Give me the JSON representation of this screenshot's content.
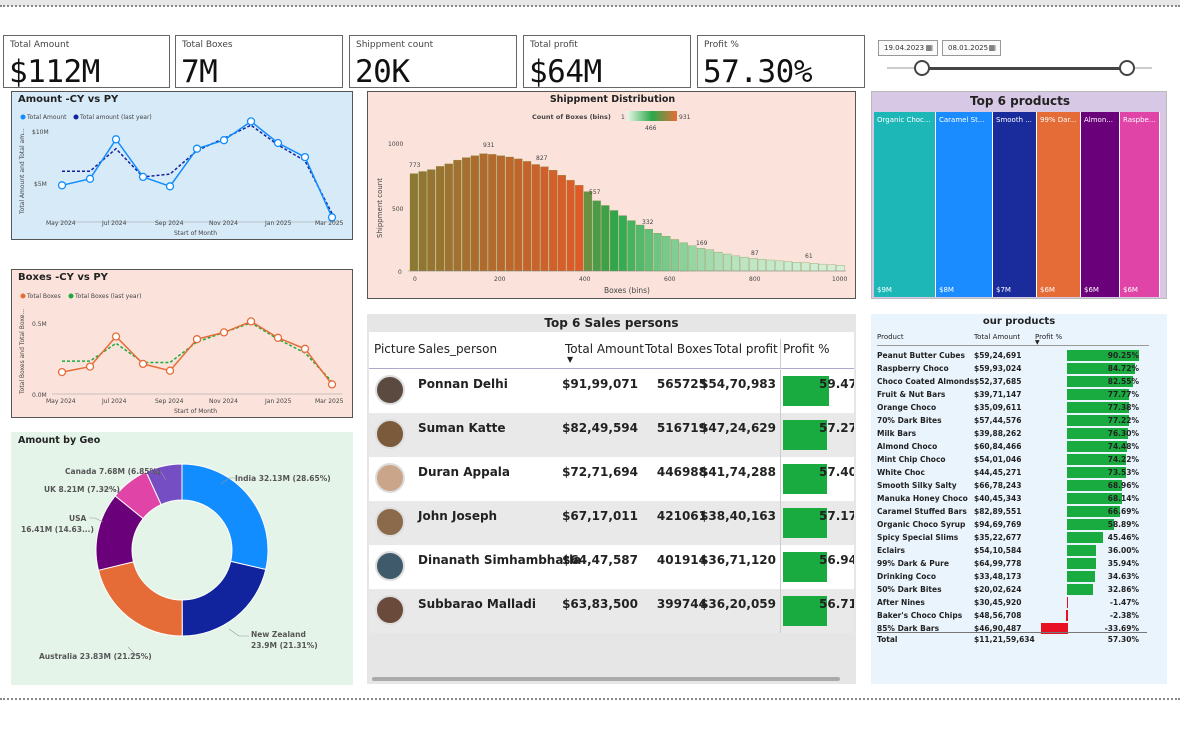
{
  "kpis": [
    {
      "label": "Total Amount",
      "value": "$112M"
    },
    {
      "label": "Total Boxes",
      "value": "7M"
    },
    {
      "label": "Shippment count",
      "value": "20K"
    },
    {
      "label": "Total profit",
      "value": "$64M"
    },
    {
      "label": "Profit %",
      "value": "57.30%"
    }
  ],
  "date_filter": {
    "start": "19.04.2023",
    "end": "08.01.2025",
    "start_pos": 0.0,
    "end_pos": 1.0
  },
  "amount_chart": {
    "title": "Amount -CY vs PY",
    "legend": [
      "Total Amount",
      "Total amount (last year)"
    ],
    "ylabel": "Total Amount and Total am...",
    "xlabel": "Start of Month",
    "yticks": [
      "$10M",
      "$5M"
    ],
    "xticks": [
      "May 2024",
      "Jul 2024",
      "Sep 2024",
      "Nov 2024",
      "Jan 2025",
      "Mar 2025"
    ]
  },
  "boxes_chart": {
    "title": "Boxes -CY vs PY",
    "legend": [
      "Total Boxes",
      "Total Boxes (last year)"
    ],
    "ylabel": "Total Boxes and Total Boxe...",
    "xlabel": "Start of Month",
    "yticks": [
      "0.5M",
      "0.0M"
    ],
    "xticks": [
      "May 2024",
      "Jul 2024",
      "Sep 2024",
      "Nov 2024",
      "Jan 2025",
      "Mar 2025"
    ]
  },
  "shipment_chart": {
    "title": "Shippment Distribution",
    "legend_label": "Count of Boxes (bins)",
    "legend_min": "1",
    "legend_mid": "466",
    "legend_max": "931",
    "xlabel": "Boxes (bins)",
    "ylabel": "Shippment count",
    "yticks": [
      "1000",
      "500",
      "0"
    ],
    "xticks": [
      "0",
      "200",
      "400",
      "600",
      "800",
      "1000"
    ],
    "labels": [
      "773",
      "931",
      "827",
      "557",
      "332",
      "169",
      "87",
      "61"
    ]
  },
  "top_products": {
    "title": "Top 6 products",
    "items": [
      {
        "name": "Organic Choc...",
        "value": "$9M",
        "color": "#1eb7b7"
      },
      {
        "name": "Caramel St...",
        "value": "$8M",
        "color": "#1a8cff"
      },
      {
        "name": "Smooth ...",
        "value": "$7M",
        "color": "#1a2b9c"
      },
      {
        "name": "99% Dar...",
        "value": "$6M",
        "color": "#e66c37"
      },
      {
        "name": "Almon...",
        "value": "$6M",
        "color": "#6b007b"
      },
      {
        "name": "Raspbe...",
        "value": "$6M",
        "color": "#e044a7"
      }
    ]
  },
  "sales_persons": {
    "title": "Top 6 Sales persons",
    "columns": [
      "Picture",
      "Sales_person",
      "Total Amount",
      "Total Boxes",
      "Total profit",
      "Profit %"
    ],
    "rows": [
      {
        "name": "Ponnan Delhi",
        "amount": "$91,99,071",
        "boxes": "565725",
        "profit": "$54,70,983",
        "pct": "59.47",
        "pct_val": 59.47
      },
      {
        "name": "Suman Katte",
        "amount": "$82,49,594",
        "boxes": "516719",
        "profit": "$47,24,629",
        "pct": "57.27",
        "pct_val": 57.27
      },
      {
        "name": "Duran Appala",
        "amount": "$72,71,694",
        "boxes": "446988",
        "profit": "$41,74,288",
        "pct": "57.40",
        "pct_val": 57.4
      },
      {
        "name": "John Joseph",
        "amount": "$67,17,011",
        "boxes": "421061",
        "profit": "$38,40,163",
        "pct": "57.17",
        "pct_val": 57.17
      },
      {
        "name": "Dinanath Simhambhatla",
        "amount": "$64,47,587",
        "boxes": "401914",
        "profit": "$36,71,120",
        "pct": "56.94",
        "pct_val": 56.94
      },
      {
        "name": "Subbarao Malladi",
        "amount": "$63,83,500",
        "boxes": "399744",
        "profit": "$36,20,059",
        "pct": "56.71",
        "pct_val": 56.71
      }
    ]
  },
  "geo_chart": {
    "title": "Amount by Geo",
    "slices": [
      {
        "label": "India 32.13M (28.65%)",
        "value": 28.65,
        "color": "#118dff"
      },
      {
        "label": "New Zealand",
        "label2": "23.9M (21.31%)",
        "value": 21.31,
        "color": "#12239e"
      },
      {
        "label": "Australia 23.83M (21.25%)",
        "value": 21.25,
        "color": "#e66c37"
      },
      {
        "label": "USA",
        "label2": "16.41M (14.63...)",
        "value": 14.63,
        "color": "#6b007b"
      },
      {
        "label": "UK 8.21M (7.32%)",
        "value": 7.32,
        "color": "#e044a7"
      },
      {
        "label": "Canada 7.68M (6.85%)",
        "value": 6.85,
        "color": "#744ec2"
      }
    ]
  },
  "our_products": {
    "title": "our products",
    "columns": [
      "Product",
      "Total Amount",
      "Profit %"
    ],
    "rows": [
      {
        "name": "Peanut Butter Cubes",
        "amount": "$59,24,691",
        "pct": "90.25%",
        "v": 90.25
      },
      {
        "name": "Raspberry Choco",
        "amount": "$59,93,024",
        "pct": "84.72%",
        "v": 84.72
      },
      {
        "name": "Choco Coated Almonds",
        "amount": "$52,37,685",
        "pct": "82.55%",
        "v": 82.55
      },
      {
        "name": "Fruit & Nut Bars",
        "amount": "$39,71,147",
        "pct": "77.77%",
        "v": 77.77
      },
      {
        "name": "Orange Choco",
        "amount": "$35,09,611",
        "pct": "77.38%",
        "v": 77.38
      },
      {
        "name": "70% Dark Bites",
        "amount": "$57,44,576",
        "pct": "77.22%",
        "v": 77.22
      },
      {
        "name": "Milk Bars",
        "amount": "$39,88,262",
        "pct": "76.30%",
        "v": 76.3
      },
      {
        "name": "Almond Choco",
        "amount": "$60,84,466",
        "pct": "74.48%",
        "v": 74.48
      },
      {
        "name": "Mint Chip Choco",
        "amount": "$54,01,046",
        "pct": "74.22%",
        "v": 74.22
      },
      {
        "name": "White Choc",
        "amount": "$44,45,271",
        "pct": "73.53%",
        "v": 73.53
      },
      {
        "name": "Smooth Silky Salty",
        "amount": "$66,78,243",
        "pct": "68.96%",
        "v": 68.96
      },
      {
        "name": "Manuka Honey Choco",
        "amount": "$40,45,343",
        "pct": "68.14%",
        "v": 68.14
      },
      {
        "name": "Caramel Stuffed Bars",
        "amount": "$82,89,551",
        "pct": "66.69%",
        "v": 66.69
      },
      {
        "name": "Organic Choco Syrup",
        "amount": "$94,69,769",
        "pct": "58.89%",
        "v": 58.89
      },
      {
        "name": "Spicy Special Slims",
        "amount": "$35,22,677",
        "pct": "45.46%",
        "v": 45.46
      },
      {
        "name": "Eclairs",
        "amount": "$54,10,584",
        "pct": "36.00%",
        "v": 36.0
      },
      {
        "name": "99% Dark & Pure",
        "amount": "$64,99,778",
        "pct": "35.94%",
        "v": 35.94
      },
      {
        "name": "Drinking Coco",
        "amount": "$33,48,173",
        "pct": "34.63%",
        "v": 34.63
      },
      {
        "name": "50% Dark Bites",
        "amount": "$20,02,624",
        "pct": "32.86%",
        "v": 32.86
      },
      {
        "name": "After Nines",
        "amount": "$30,45,920",
        "pct": "-1.47%",
        "v": -1.47
      },
      {
        "name": "Baker's Choco Chips",
        "amount": "$48,56,708",
        "pct": "-2.38%",
        "v": -2.38
      },
      {
        "name": "85% Dark Bars",
        "amount": "$46,90,487",
        "pct": "-33.69%",
        "v": -33.69
      }
    ],
    "total": {
      "name": "Total",
      "amount": "$11,21,59,634",
      "pct": "57.30%"
    }
  },
  "colors": {
    "green": "#1aab40",
    "red": "#e81123",
    "orange": "#e66c37",
    "blue": "#118dff",
    "navy": "#12239e"
  }
}
